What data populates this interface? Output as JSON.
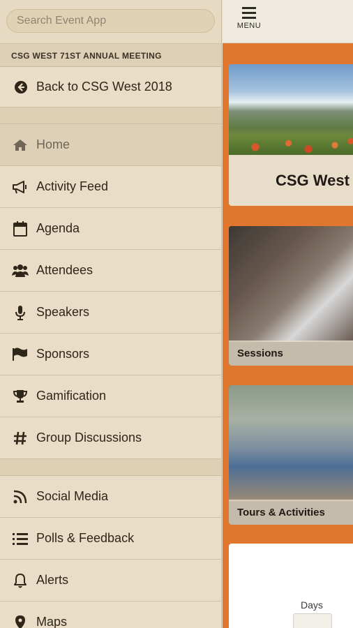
{
  "search": {
    "placeholder": "Search Event App"
  },
  "event": {
    "name": "CSG WEST 71ST ANNUAL MEETING"
  },
  "back": {
    "label": "Back to CSG West 2018"
  },
  "nav_group1": [
    {
      "label": "Home",
      "icon": "home-icon"
    },
    {
      "label": "Activity Feed",
      "icon": "megaphone-icon"
    },
    {
      "label": "Agenda",
      "icon": "calendar-icon"
    },
    {
      "label": "Attendees",
      "icon": "people-icon"
    },
    {
      "label": "Speakers",
      "icon": "microphone-icon"
    },
    {
      "label": "Sponsors",
      "icon": "flag-icon"
    },
    {
      "label": "Gamification",
      "icon": "trophy-icon"
    },
    {
      "label": "Group Discussions",
      "icon": "hashtag-icon"
    }
  ],
  "nav_group2": [
    {
      "label": "Social Media",
      "icon": "rss-icon"
    },
    {
      "label": "Polls & Feedback",
      "icon": "list-icon"
    },
    {
      "label": "Alerts",
      "icon": "bell-icon"
    },
    {
      "label": "Maps",
      "icon": "map-pin-icon"
    }
  ],
  "topbar": {
    "menu_label": "MENU"
  },
  "cards": {
    "hero_title": "CSG West",
    "sessions_label": "Sessions",
    "tours_label": "Tours & Activities",
    "countdown_label": "Days"
  },
  "colors": {
    "accent": "#e1772f",
    "sidebar_bg": "#e7dbc5"
  }
}
